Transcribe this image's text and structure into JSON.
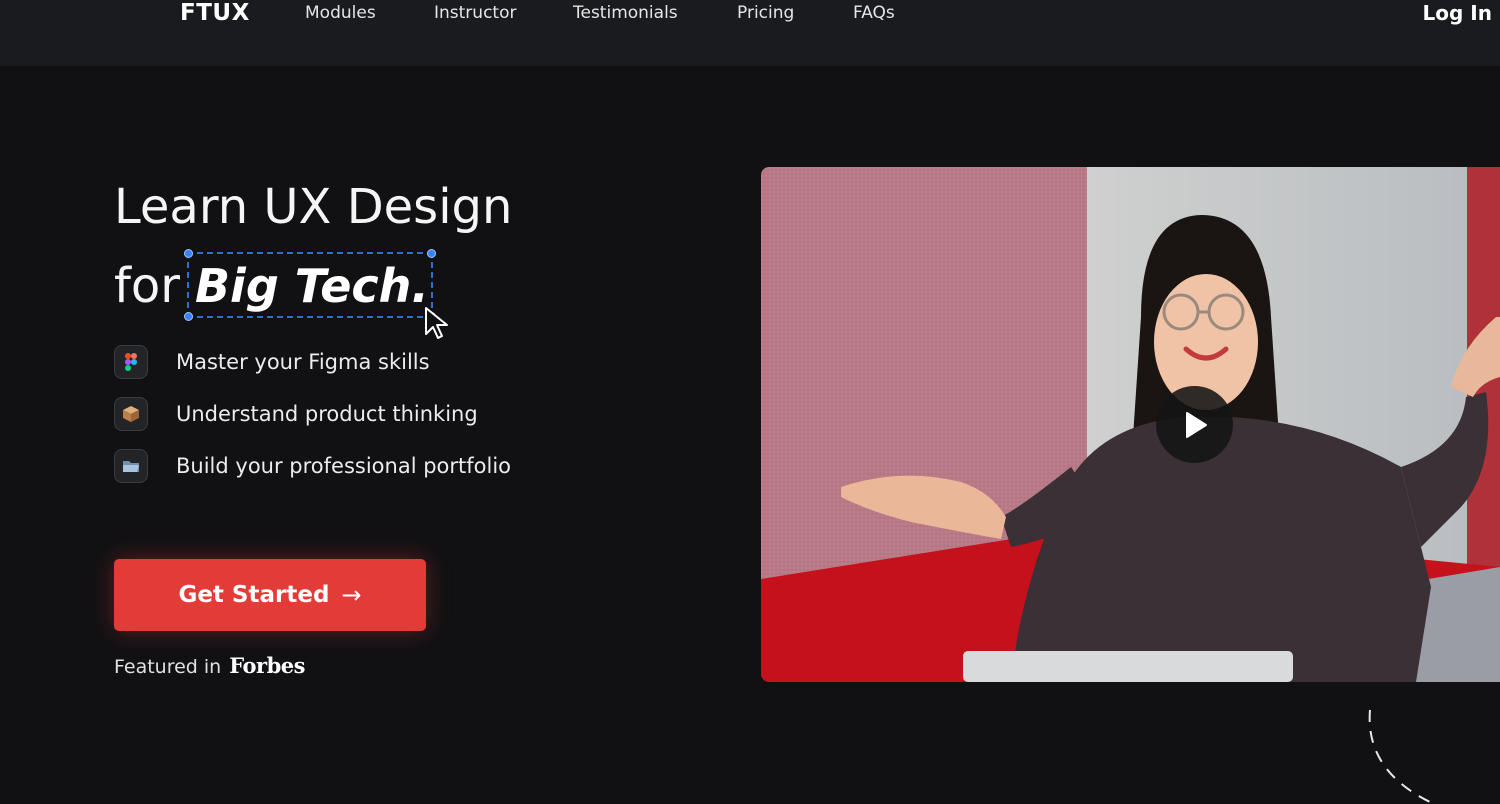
{
  "nav": {
    "logo": "FTUX",
    "links": [
      "Modules",
      "Instructor",
      "Testimonials",
      "Pricing",
      "FAQs"
    ],
    "login": "Log In"
  },
  "hero": {
    "title_line1": "Learn UX Design",
    "title_for": "for",
    "title_highlight": "Big Tech.",
    "features": [
      {
        "icon": "figma-icon",
        "text": "Master your Figma skills"
      },
      {
        "icon": "package-icon",
        "text": "Understand product thinking"
      },
      {
        "icon": "folder-icon",
        "text": "Build your professional portfolio"
      }
    ],
    "cta_label": "Get Started",
    "cta_arrow": "→",
    "featured_prefix": "Featured in",
    "featured_brand": "Forbes"
  },
  "colors": {
    "background": "#111113",
    "nav_background": "#1a1b1f",
    "cta": "#e23b38",
    "selection": "#2f6fd1"
  }
}
